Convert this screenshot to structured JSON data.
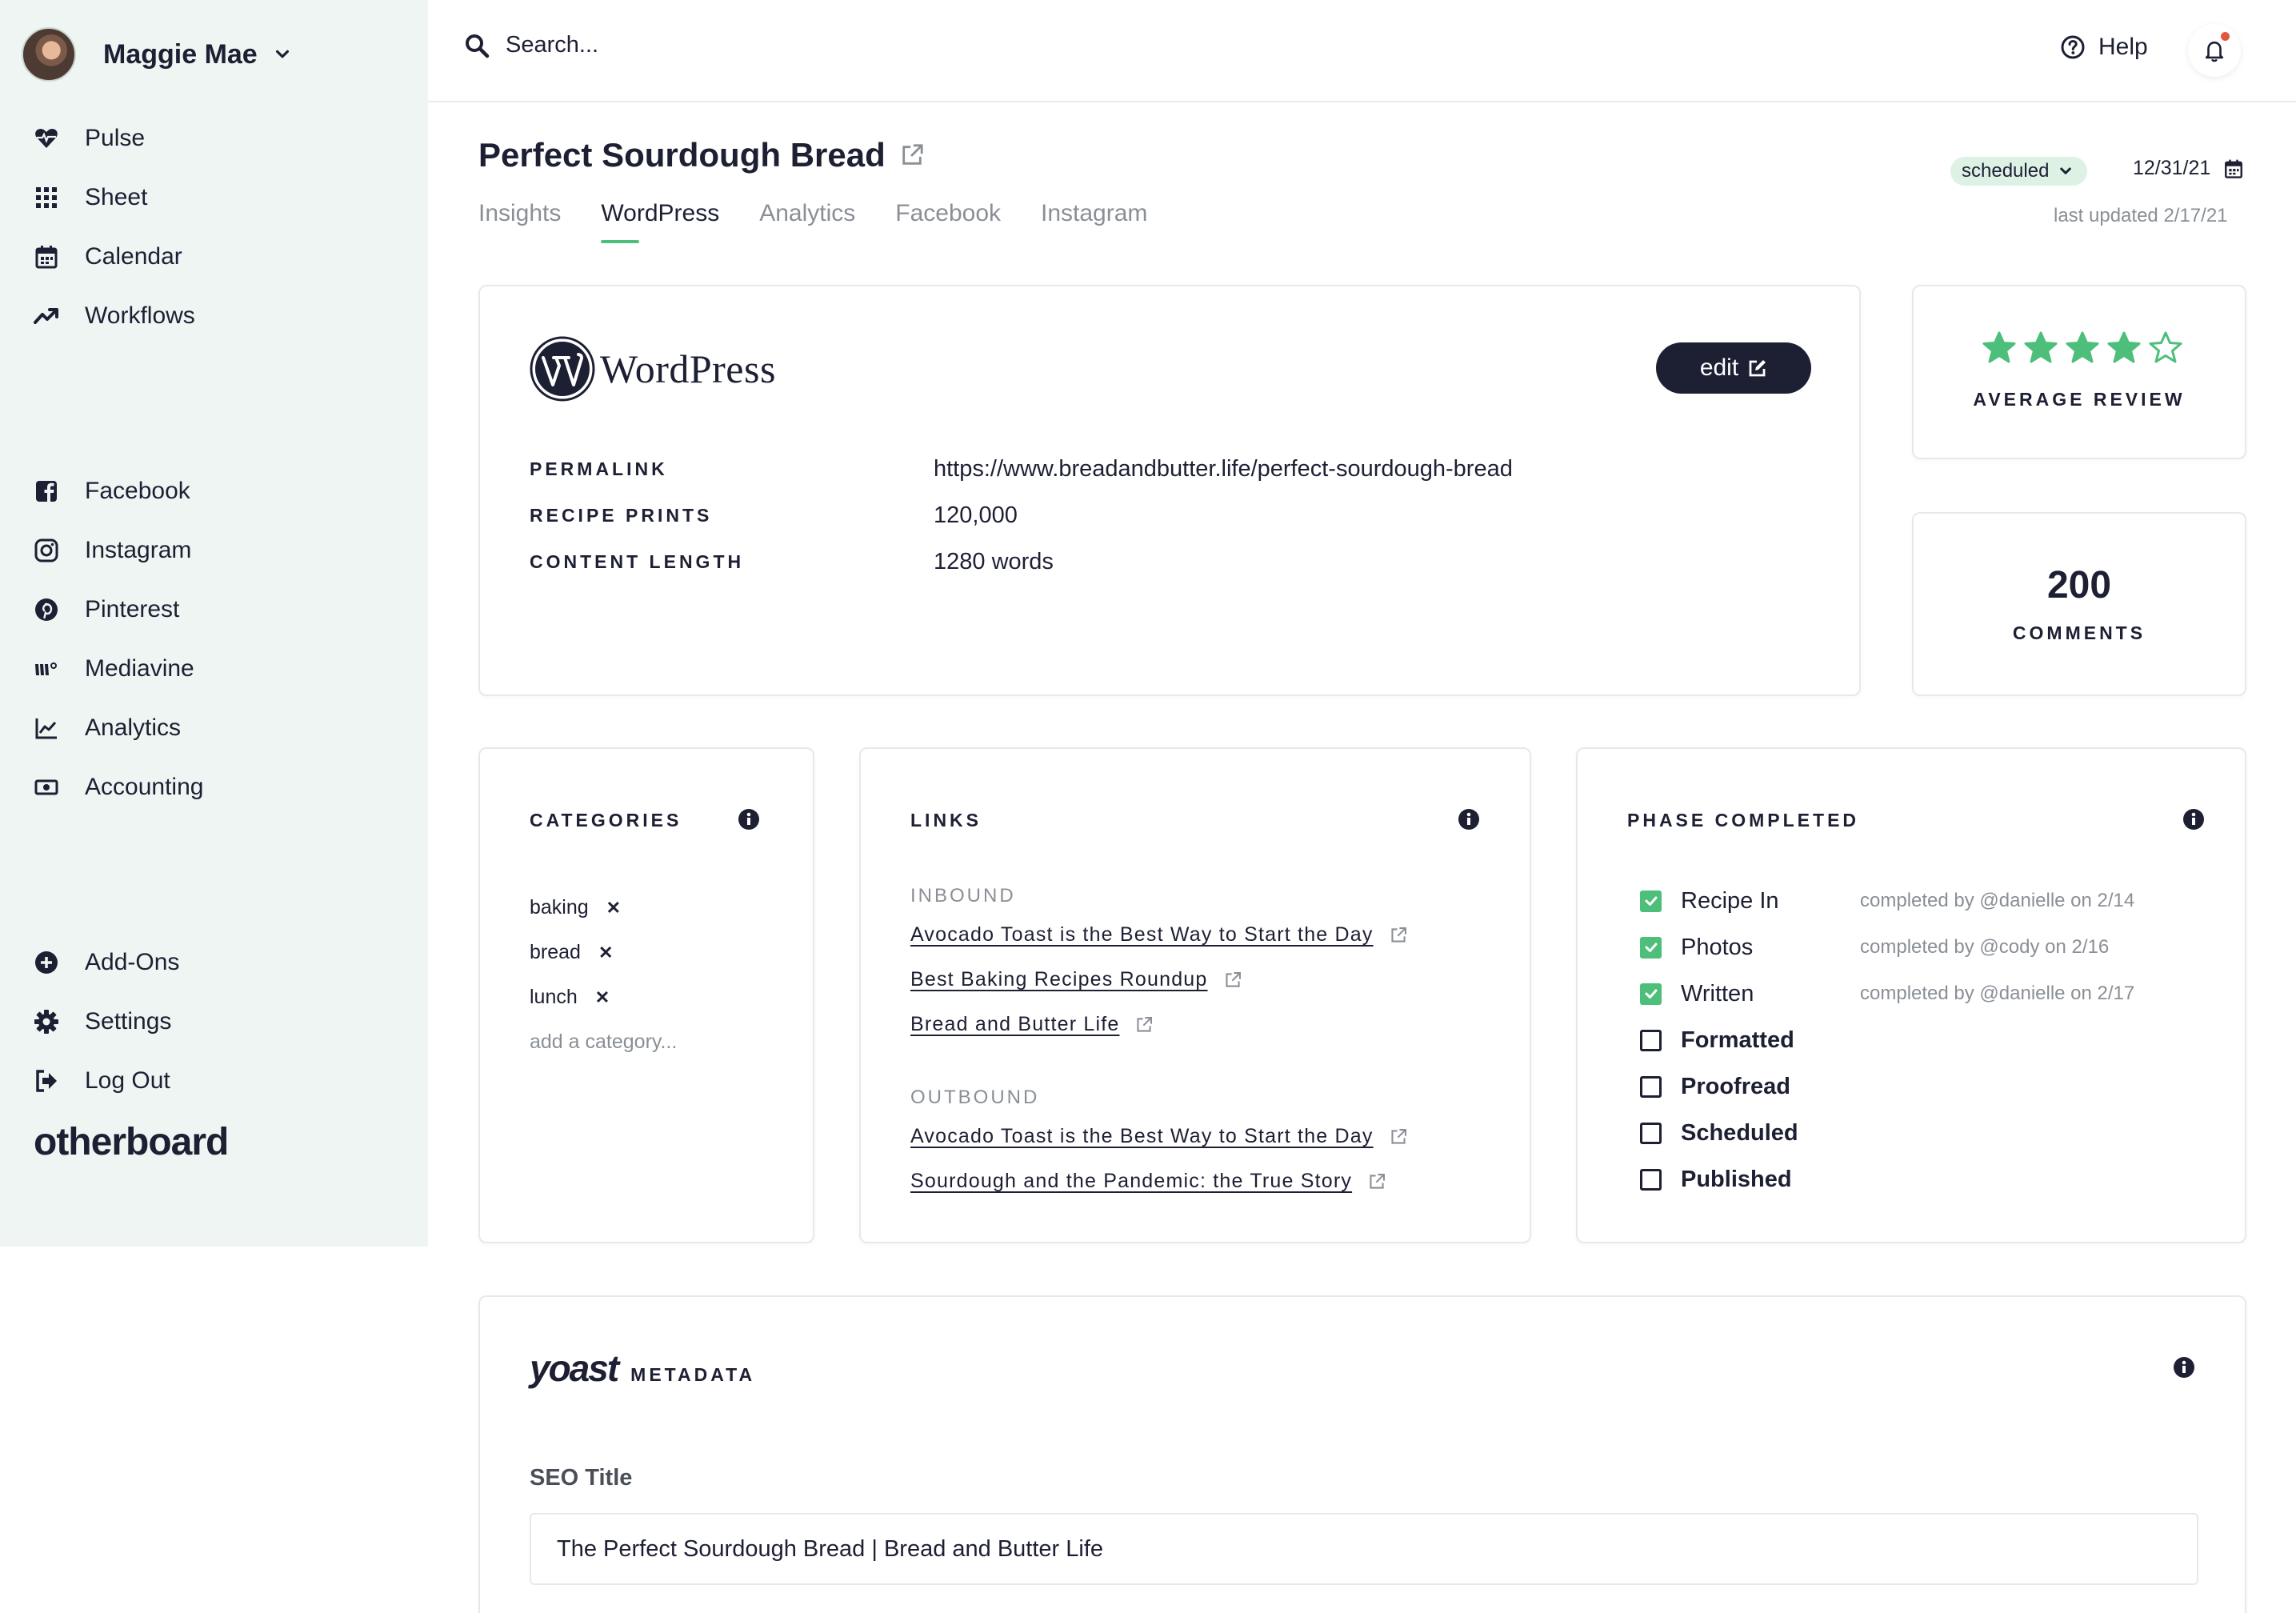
{
  "user": {
    "name": "Maggie Mae"
  },
  "nav_primary": [
    {
      "label": "Pulse",
      "icon": "heart-pulse-icon"
    },
    {
      "label": "Sheet",
      "icon": "grid-icon"
    },
    {
      "label": "Calendar",
      "icon": "calendar-icon"
    },
    {
      "label": "Workflows",
      "icon": "trend-icon"
    }
  ],
  "nav_channels": [
    {
      "label": "Facebook",
      "icon": "facebook-icon"
    },
    {
      "label": "Instagram",
      "icon": "instagram-icon"
    },
    {
      "label": "Pinterest",
      "icon": "pinterest-icon"
    },
    {
      "label": "Mediavine",
      "icon": "mediavine-icon"
    },
    {
      "label": "Analytics",
      "icon": "chart-icon"
    },
    {
      "label": "Accounting",
      "icon": "money-icon"
    }
  ],
  "nav_footer": [
    {
      "label": "Add-Ons",
      "icon": "plus-circle-icon"
    },
    {
      "label": "Settings",
      "icon": "gear-icon"
    },
    {
      "label": "Log Out",
      "icon": "logout-icon"
    }
  ],
  "brand": "otherboard",
  "search": {
    "placeholder": "Search..."
  },
  "help_label": "Help",
  "post": {
    "title": "Perfect Sourdough Bread",
    "tabs": [
      "Insights",
      "WordPress",
      "Analytics",
      "Facebook",
      "Instagram"
    ],
    "active_tab": "WordPress",
    "status": "scheduled",
    "date": "12/31/21",
    "last_updated": "last updated  2/17/21"
  },
  "wordpress": {
    "logo_text": "WordPress",
    "edit_label": "edit",
    "rows": [
      {
        "key": "PERMALINK",
        "value": "https://www.breadandbutter.life/perfect-sourdough-bread"
      },
      {
        "key": "RECIPE PRINTS",
        "value": "120,000"
      },
      {
        "key": "CONTENT LENGTH",
        "value": "1280 words"
      }
    ]
  },
  "review": {
    "rating": 4,
    "max": 5,
    "label": "AVERAGE REVIEW"
  },
  "comments": {
    "value": "200",
    "label": "COMMENTS"
  },
  "categories": {
    "title": "CATEGORIES",
    "items": [
      "baking",
      "bread",
      "lunch"
    ],
    "add_placeholder": "add a category..."
  },
  "links": {
    "title": "LINKS",
    "inbound_label": "INBOUND",
    "inbound": [
      "Avocado Toast is the Best Way to Start the Day",
      "Best Baking Recipes Roundup",
      "Bread and Butter Life"
    ],
    "outbound_label": "OUTBOUND",
    "outbound": [
      "Avocado Toast is the Best Way to Start the Day",
      "Sourdough and the Pandemic: the True Story"
    ]
  },
  "phases": {
    "title": "PHASE COMPLETED",
    "items": [
      {
        "label": "Recipe In",
        "done": true,
        "note": "completed by @danielle on 2/14"
      },
      {
        "label": "Photos",
        "done": true,
        "note": "completed by @cody on 2/16"
      },
      {
        "label": "Written",
        "done": true,
        "note": "completed by @danielle on 2/17"
      },
      {
        "label": "Formatted",
        "done": false,
        "note": ""
      },
      {
        "label": "Proofread",
        "done": false,
        "note": ""
      },
      {
        "label": "Scheduled",
        "done": false,
        "note": ""
      },
      {
        "label": "Published",
        "done": false,
        "note": ""
      }
    ]
  },
  "yoast": {
    "logo": "yoast",
    "subtitle": "METADATA",
    "seo_title_label": "SEO Title",
    "seo_title_value": "The Perfect Sourdough Bread | Bread and Butter Life"
  },
  "colors": {
    "accent": "#4dbf7a",
    "dark": "#1d1f33",
    "sidebar_bg": "#eef5f2",
    "muted": "#8a8f96",
    "notification": "#e5573d"
  }
}
